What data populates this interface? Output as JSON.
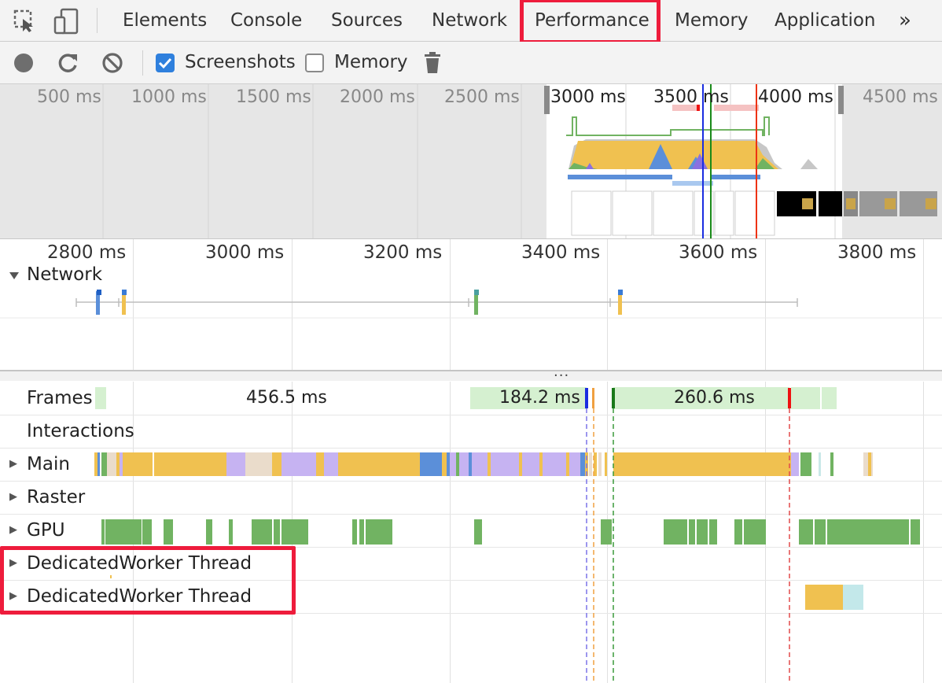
{
  "tabs": {
    "elements": "Elements",
    "console": "Console",
    "sources": "Sources",
    "network": "Network",
    "performance": "Performance",
    "memory": "Memory",
    "application": "Application",
    "more": "»"
  },
  "toolbar": {
    "screenshots_label": "Screenshots",
    "screenshots_checked": true,
    "memory_label": "Memory",
    "memory_checked": false
  },
  "overview": {
    "labels": [
      "500 ms",
      "1000 ms",
      "1500 ms",
      "2000 ms",
      "2500 ms",
      "3000 ms",
      "3500 ms",
      "4000 ms",
      "4500 ms"
    ]
  },
  "ruler": {
    "labels": [
      "2800 ms",
      "3000 ms",
      "3200 ms",
      "3400 ms",
      "3600 ms",
      "3800 ms"
    ]
  },
  "network_section": {
    "title": "Network"
  },
  "splitter": "...",
  "tracks": {
    "frames": {
      "label": "Frames",
      "durations": [
        "456.5 ms",
        "184.2 ms",
        "260.6 ms"
      ]
    },
    "interactions": "Interactions",
    "main": "Main",
    "raster": "Raster",
    "gpu": "GPU",
    "worker1": "DedicatedWorker Thread",
    "worker2": "DedicatedWorker Thread"
  },
  "colors": {
    "highlight_red": "#ee1c3c",
    "scripting_yellow": "#f0c150",
    "loading_blue": "#5b8fd9",
    "rendering_purple": "#c6b3f2",
    "painting_green": "#71b362",
    "frame_green": "#d5f0d0",
    "idle_beige": "#eadccb",
    "checkbox_blue": "#2f80dd"
  }
}
